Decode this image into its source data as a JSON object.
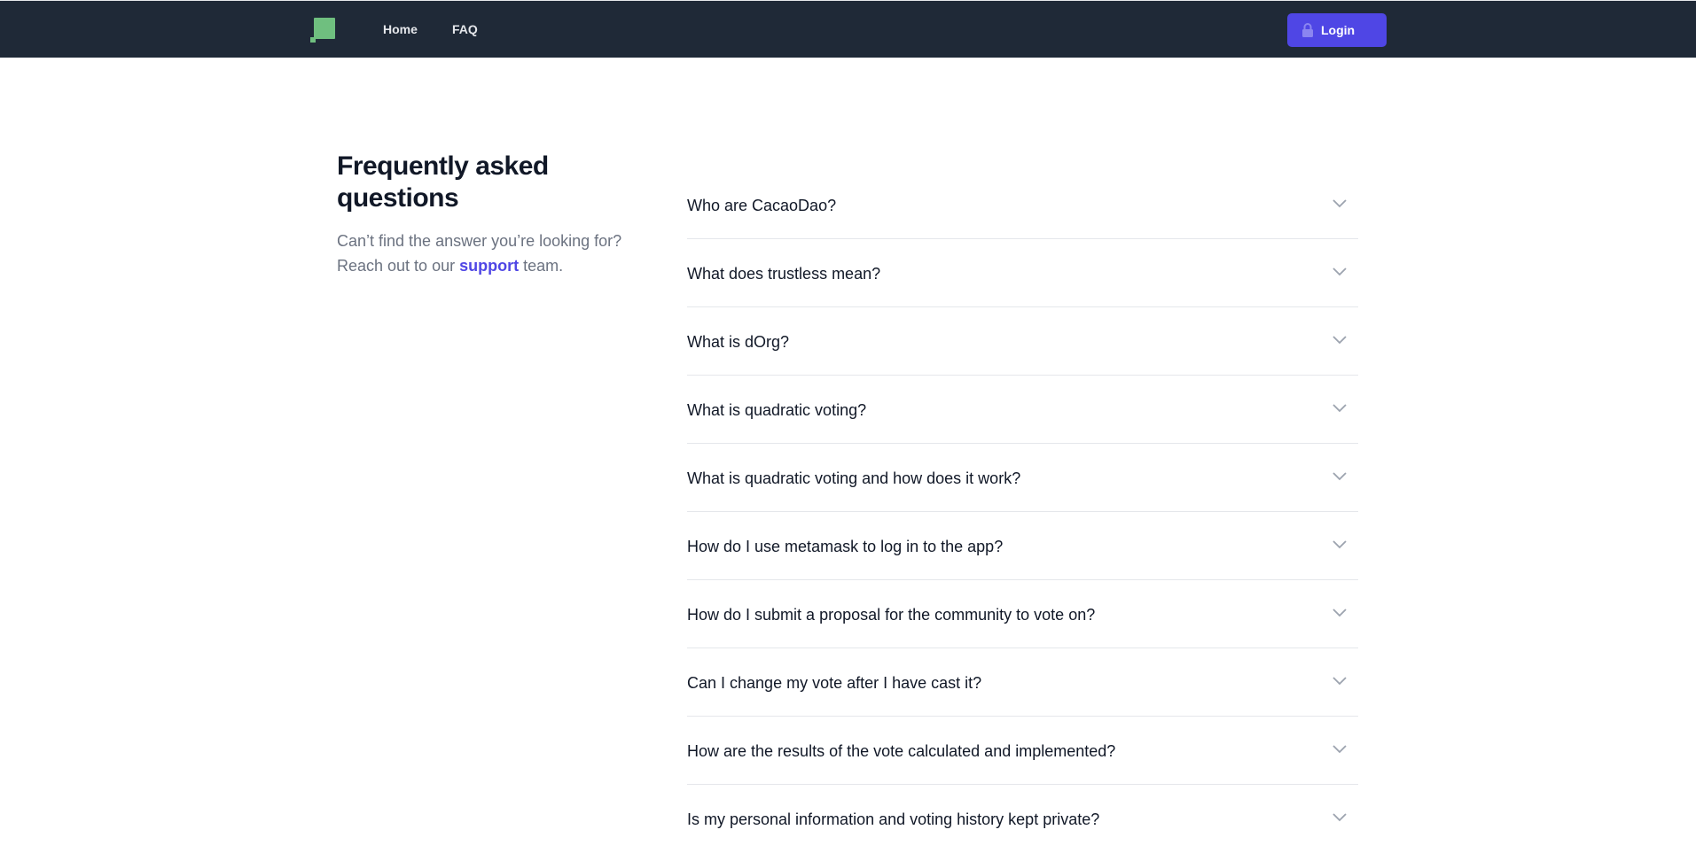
{
  "nav": {
    "logo_icon": "logo-square-icon",
    "links": [
      {
        "label": "Home"
      },
      {
        "label": "FAQ"
      }
    ],
    "login": {
      "label": "Login",
      "icon": "lock-icon"
    }
  },
  "intro": {
    "title": "Frequently asked questions",
    "subtitle_before": "Can’t find the answer you’re looking for? Reach out to our ",
    "support_link": "support",
    "subtitle_after": " team."
  },
  "faq": {
    "items": [
      {
        "question": "Who are CacaoDao?"
      },
      {
        "question": "What does trustless mean?"
      },
      {
        "question": "What is dOrg?"
      },
      {
        "question": "What is quadratic voting?"
      },
      {
        "question": "What is quadratic voting and how does it work?"
      },
      {
        "question": "How do I use metamask to log in to the app?"
      },
      {
        "question": "How do I submit a proposal for the community to vote on?"
      },
      {
        "question": "Can I change my vote after I have cast it?"
      },
      {
        "question": "How are the results of the vote calculated and implemented?"
      },
      {
        "question": "Is my personal information and voting history kept private?"
      }
    ],
    "expand_icon": "chevron-down-icon"
  },
  "colors": {
    "navbar_bg": "#1f2937",
    "accent": "#4f46e5",
    "logo": "#6fbf7f",
    "heading": "#111827",
    "muted": "#6b7280"
  }
}
